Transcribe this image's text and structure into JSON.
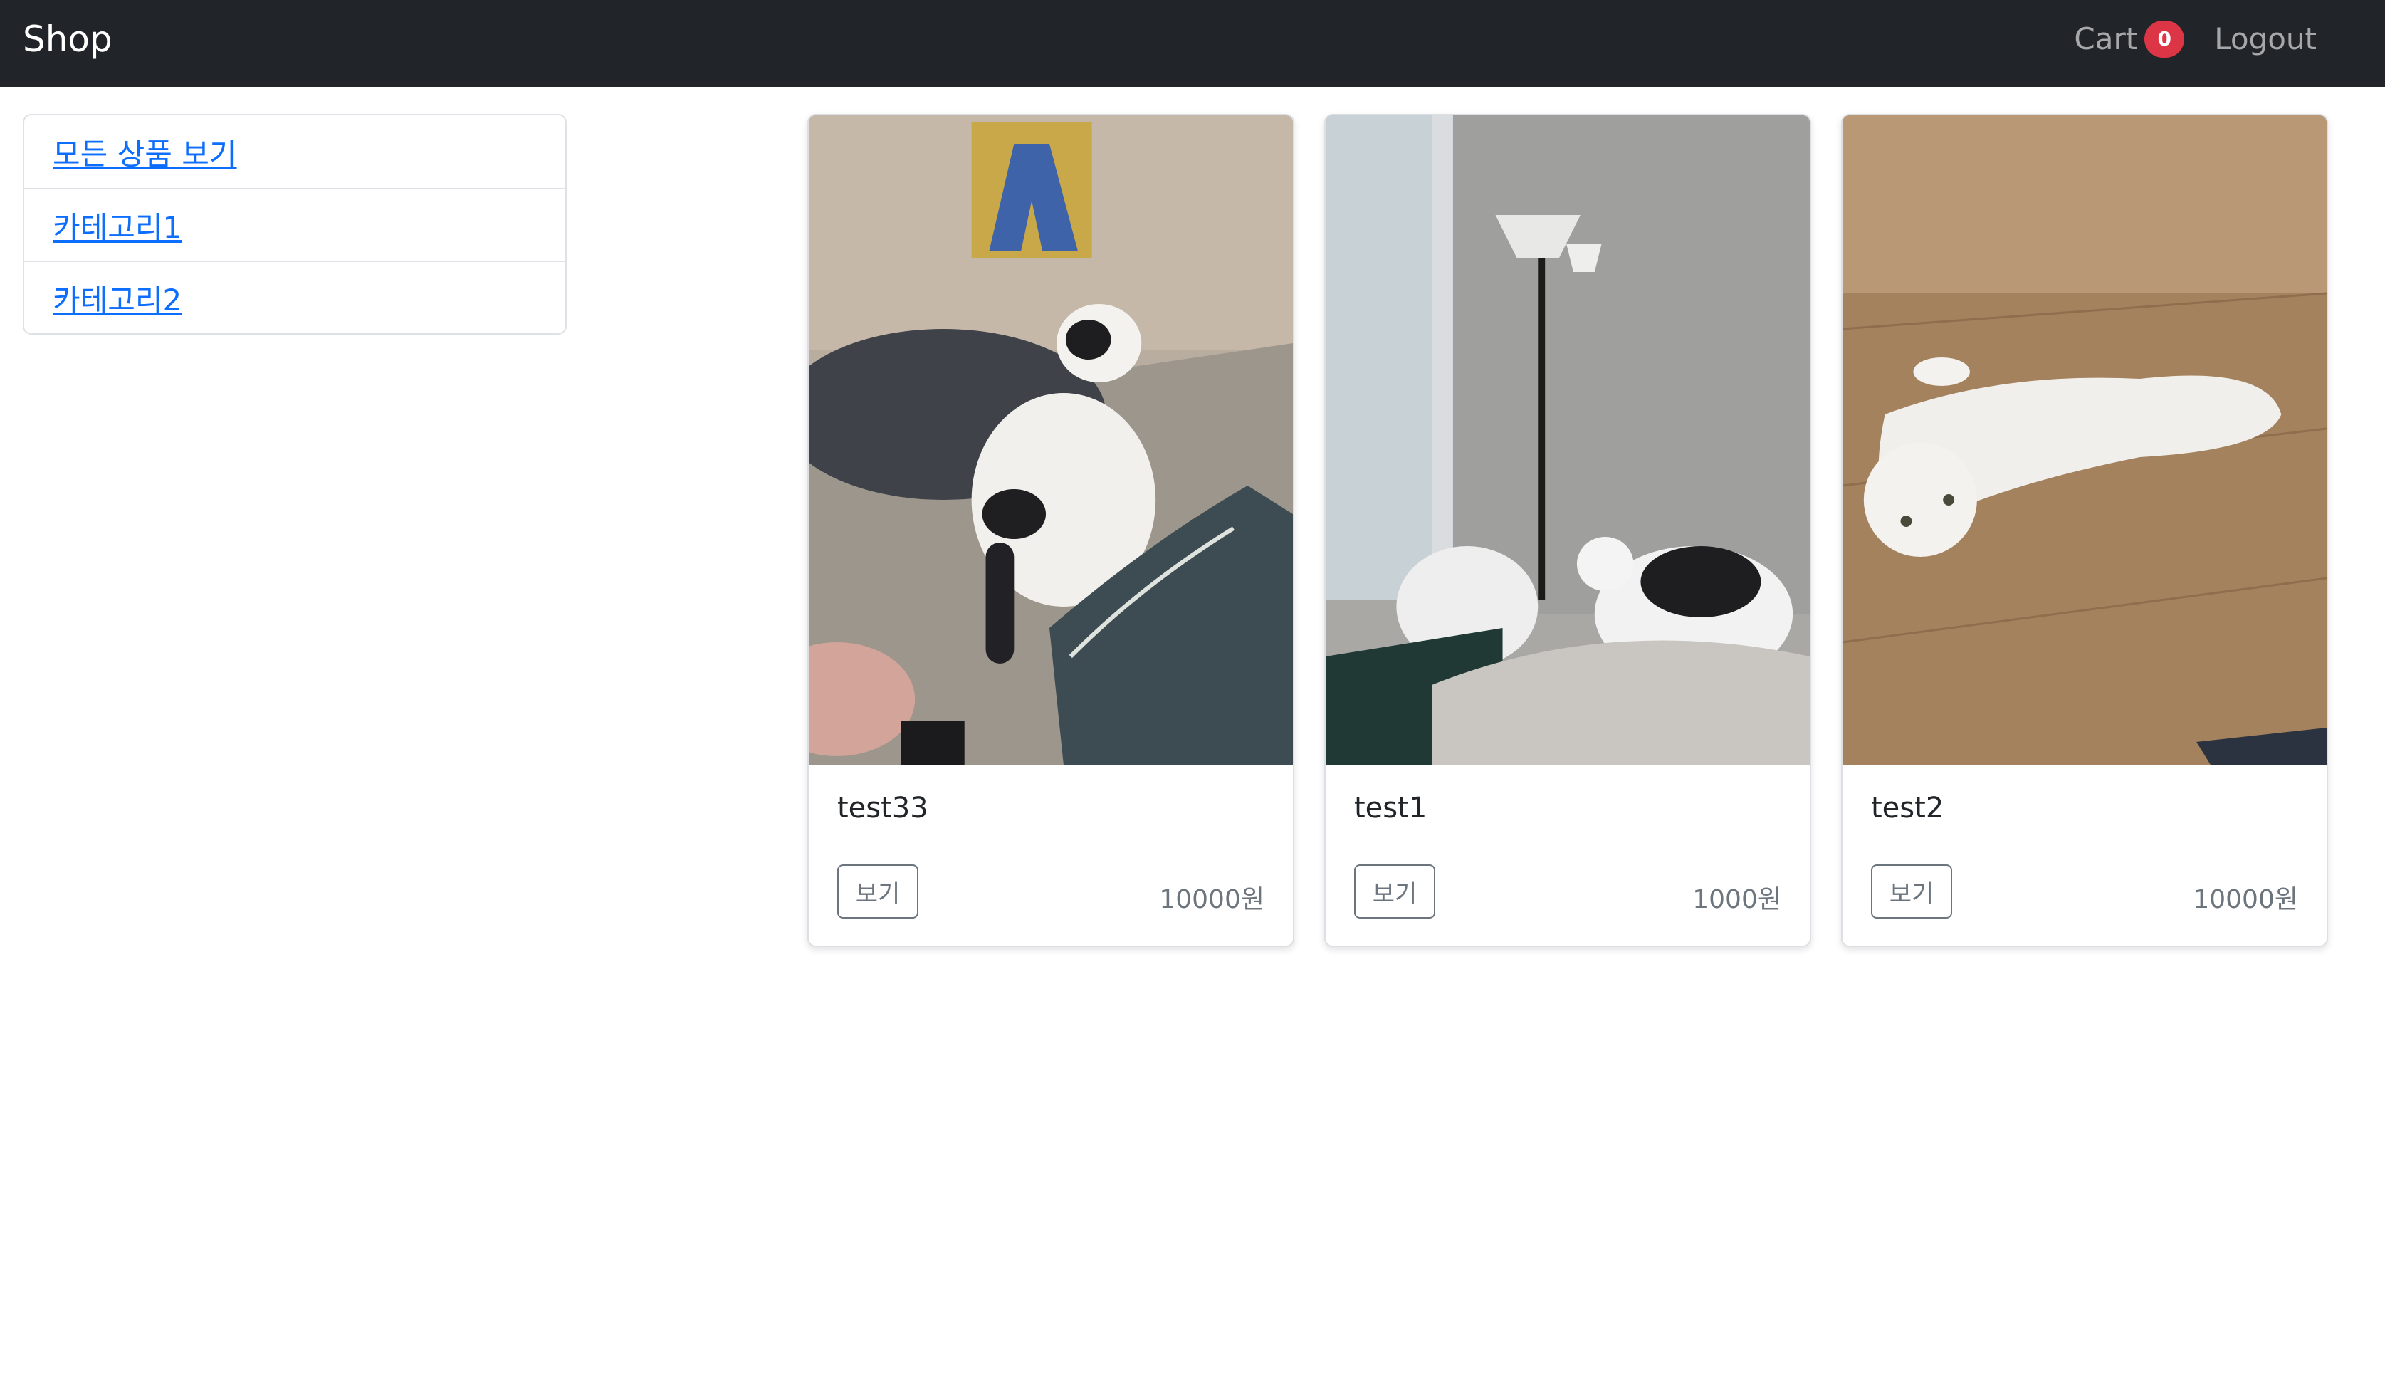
{
  "navbar": {
    "brand": "Shop",
    "cart_label": "Cart",
    "cart_count": "0",
    "logout_label": "Logout"
  },
  "sidebar": {
    "items": [
      {
        "label": "모든 상품 보기"
      },
      {
        "label": "카테고리1"
      },
      {
        "label": "카테고리2"
      }
    ]
  },
  "products": [
    {
      "name": "test33",
      "button": "보기",
      "price": "10000원"
    },
    {
      "name": "test1",
      "button": "보기",
      "price": "1000원"
    },
    {
      "name": "test2",
      "button": "보기",
      "price": "10000원"
    }
  ],
  "colors": {
    "navbar_bg": "#212529",
    "badge": "#dc3545",
    "link": "#0d6efd"
  }
}
